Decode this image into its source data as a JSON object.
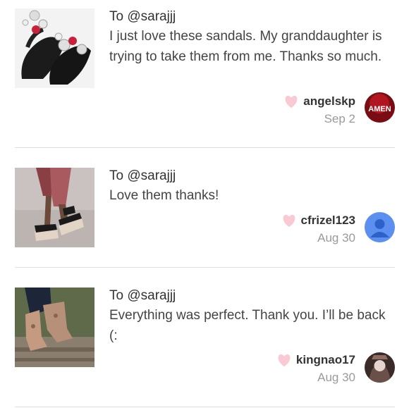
{
  "reviews": [
    {
      "to": "To @sarajjj",
      "message": "I just love these sandals. My granddaughter is trying to take them from me. Thanks so much.",
      "username": "angelskp",
      "date": "Sep 2",
      "avatar_text": "AMEN",
      "thumb_icon": "jeweled-sandals-photo",
      "heart_color": "#f9c9d4"
    },
    {
      "to": "To @sarajjj",
      "message": "Love them thanks!",
      "username": "cfrizel123",
      "date": "Aug 30",
      "thumb_icon": "platform-sandals-photo",
      "avatar_icon": "default-person-avatar",
      "avatar_color": "#5b8ff0"
    },
    {
      "to": "To @sarajjj",
      "message": "Everything was perfect. Thank you. I’ll be back (:",
      "username": "kingnao17",
      "date": "Aug 30",
      "thumb_icon": "ankle-boots-photo",
      "avatar_icon": "profile-photo-avatar"
    }
  ]
}
